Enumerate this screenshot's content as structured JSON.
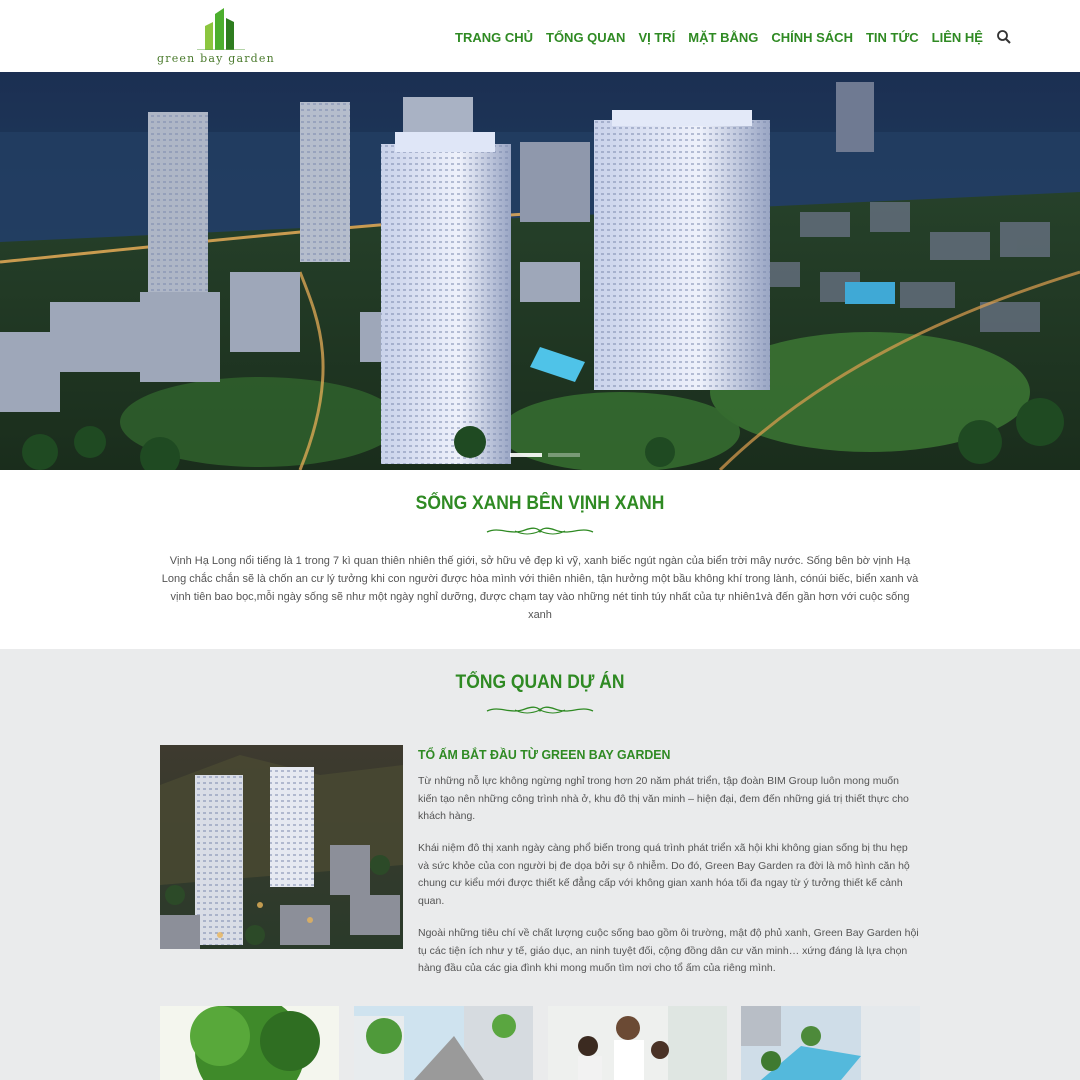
{
  "header": {
    "logo_text": "green bay garden",
    "nav": [
      "TRANG CHỦ",
      "TỔNG QUAN",
      "VỊ TRÍ",
      "MẶT BẰNG",
      "CHÍNH SÁCH",
      "TIN TỨC",
      "LIÊN HỆ"
    ],
    "search_icon": "search-icon"
  },
  "intro": {
    "title": "SỐNG XANH BÊN VỊNH XANH",
    "text": "Vịnh Hạ Long nổi tiếng là 1 trong 7 kì quan thiên nhiên thế giới, sở hữu vẻ đẹp kì vỹ, xanh biếc ngút ngàn của biển trời mây nước. Sống bên bờ vịnh Hạ Long chắc chắn sẽ là chốn an cư lý tưởng khi con người được hòa mình với thiên nhiên, tận hưởng một bầu không khí trong lành, cónúi biếc, biển xanh và vịnh tiên bao bọc,mỗi ngày sống sẽ như một ngày nghỉ dưỡng, được chạm tay vào những nét tinh túy nhất của tự nhiên1và đến gần hơn với cuộc sống xanh"
  },
  "overview": {
    "title": "TỔNG QUAN DỰ ÁN",
    "subtitle": "TỔ ẤM BẮT ĐẦU TỪ GREEN BAY GARDEN",
    "paragraphs": [
      "Từ những nỗ lực không ngừng nghỉ trong hơn 20 năm phát triển, tập đoàn BIM Group luôn mong muốn kiến tạo nên những công trình nhà ở, khu đô thị văn minh – hiện đại, đem đến những giá trị thiết thực cho khách hàng.",
      "Khái niệm đô thị xanh ngày càng phổ biến trong quá trình phát triển xã hội khi không gian sống bị thu hẹp và sức khỏe của con người bị đe dọa bởi sự ô nhiễm. Do đó, Green Bay Garden ra đời là mô hình căn hộ chung cư kiểu mới được thiết kế đẳng cấp với không gian xanh hóa tối đa ngay từ ý tưởng thiết kế cảnh quan.",
      "Ngoài những tiêu chí về chất lượng cuộc sống bao gồm ôi trường, mật độ phủ xanh, Green Bay Garden hội tụ các tiện ích như y tế, giáo dục, an ninh tuyệt đối, cộng đồng dân cư văn minh… xứng đáng là lựa chọn hàng đầu của các gia đình khi mong muốn tìm nơi cho tổ ấm của riêng mình."
    ]
  },
  "colors": {
    "brand_green": "#2f8a23",
    "section_gray": "#eaebec"
  }
}
